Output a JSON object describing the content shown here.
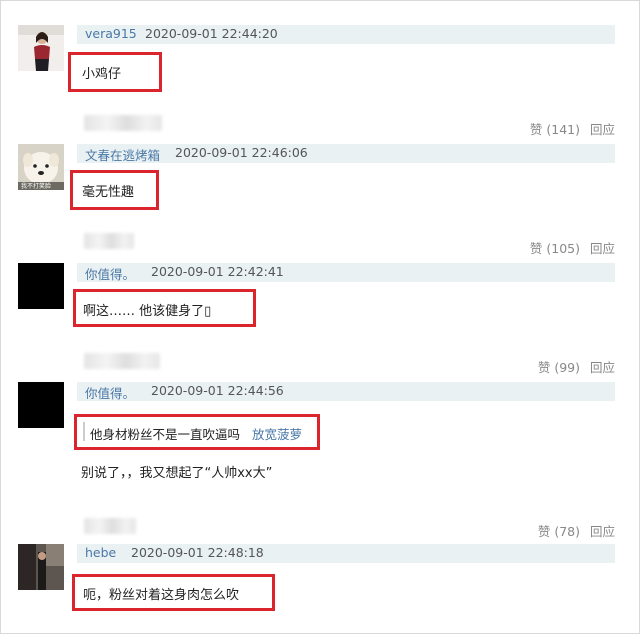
{
  "comments": [
    {
      "username": "vera915",
      "timestamp": "2020-09-01 22:44:20",
      "text": "小鸡仔",
      "likes_label": "赞 (141)",
      "reply_label": "回应"
    },
    {
      "username": "文春在逃烤箱",
      "timestamp": "2020-09-01 22:46:06",
      "text": "毫无性趣",
      "avatar_caption": "我不打笑脸",
      "likes_label": "赞 (105)",
      "reply_label": "回应"
    },
    {
      "username": "你值得。",
      "timestamp": "2020-09-01 22:42:41",
      "text": "啊这…… 他该健身了▯",
      "likes_label": "赞 (99)",
      "reply_label": "回应"
    },
    {
      "username": "你值得。",
      "timestamp": "2020-09-01 22:44:56",
      "quote_text": "他身材粉丝不是一直吹逼吗",
      "quote_author": "放宽菠萝",
      "text": "别说了，，我又想起了“人帅xx大”",
      "likes_label": "赞 (78)",
      "reply_label": "回应"
    },
    {
      "username": "hebe",
      "timestamp": "2020-09-01 22:48:18",
      "text": "呃，粉丝对着这身肉怎么吹"
    }
  ]
}
